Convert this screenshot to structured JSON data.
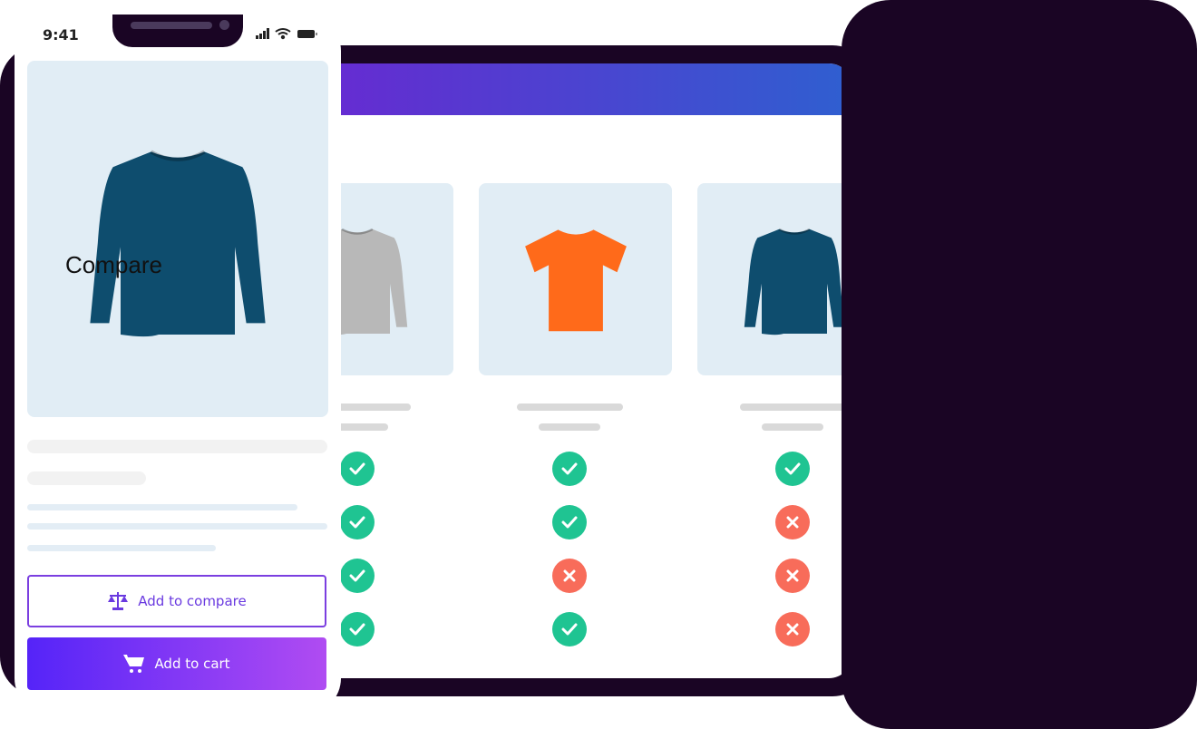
{
  "colors": {
    "check": "#1fc492",
    "cross": "#f86c5a",
    "accent": "#6a3ae0",
    "card_bg": "#e1edf5"
  },
  "compare": {
    "title": "Compare",
    "products": [
      {
        "icon": "sweater-gray-image",
        "color": "#b8b8b8"
      },
      {
        "icon": "tshirt-orange-image",
        "color": "#ff6a1a"
      },
      {
        "icon": "sweater-teal-image",
        "color": "#0e4d6e"
      }
    ],
    "rows": [
      [
        "check",
        "check",
        "check"
      ],
      [
        "check",
        "check",
        "cross"
      ],
      [
        "check",
        "cross",
        "cross"
      ],
      [
        "check",
        "check",
        "cross"
      ]
    ]
  },
  "phone": {
    "status": {
      "time": "9:41",
      "icons": [
        "signal-icon",
        "wifi-icon",
        "battery-icon"
      ]
    },
    "product": {
      "icon": "sweater-teal-image",
      "color": "#0e4d6e"
    },
    "compare_button": {
      "label": "Add to compare",
      "icon": "scale-icon"
    },
    "cart_button": {
      "label": "Add to cart",
      "icon": "cart-icon"
    }
  }
}
